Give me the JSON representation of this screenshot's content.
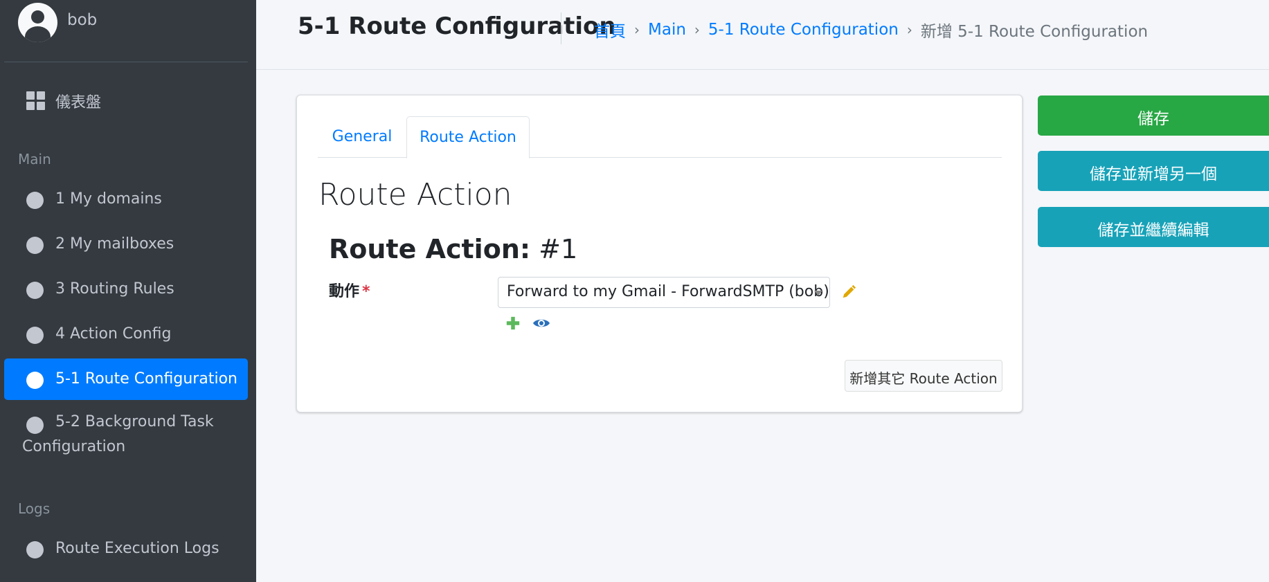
{
  "sidebar": {
    "user": {
      "name": "bob"
    },
    "dashboard": {
      "label": "儀表盤"
    },
    "headers": {
      "main": "Main",
      "logs": "Logs"
    },
    "items": [
      {
        "label": "1 My domains"
      },
      {
        "label": "2 My mailboxes"
      },
      {
        "label": "3 Routing Rules"
      },
      {
        "label": "4 Action Config"
      },
      {
        "label": "5-1 Route Configuration",
        "active": true
      },
      {
        "label": "5-2 Background Task Configuration"
      }
    ],
    "logs_items": [
      {
        "label": "Route Execution Logs"
      }
    ]
  },
  "header": {
    "title": "5-1 Route Configuration",
    "breadcrumb": {
      "home": "首頁",
      "main": "Main",
      "section": "5-1 Route Configuration",
      "current": "新增 5-1 Route Configuration"
    }
  },
  "form": {
    "tabs": {
      "general": "General",
      "route_action": "Route Action"
    },
    "section_title": "Route Action",
    "inline_title": {
      "label": "Route Action:",
      "index": "#1"
    },
    "action_field": {
      "label": "動作",
      "required_mark": "*",
      "selected": "Forward to my Gmail - ForwardSMTP (bob)"
    },
    "add_another": "新增其它 Route Action"
  },
  "actions": {
    "save": "儲存",
    "save_add_another": "儲存並新增另一個",
    "save_continue": "儲存並繼續編輯"
  },
  "colors": {
    "sidebar_bg": "#343a40",
    "active_bg": "#007bff",
    "link": "#007bff",
    "save": "#28a745",
    "secondary": "#17a2b8",
    "edit_icon": "#e0a800",
    "add_icon": "#5cb85c"
  }
}
